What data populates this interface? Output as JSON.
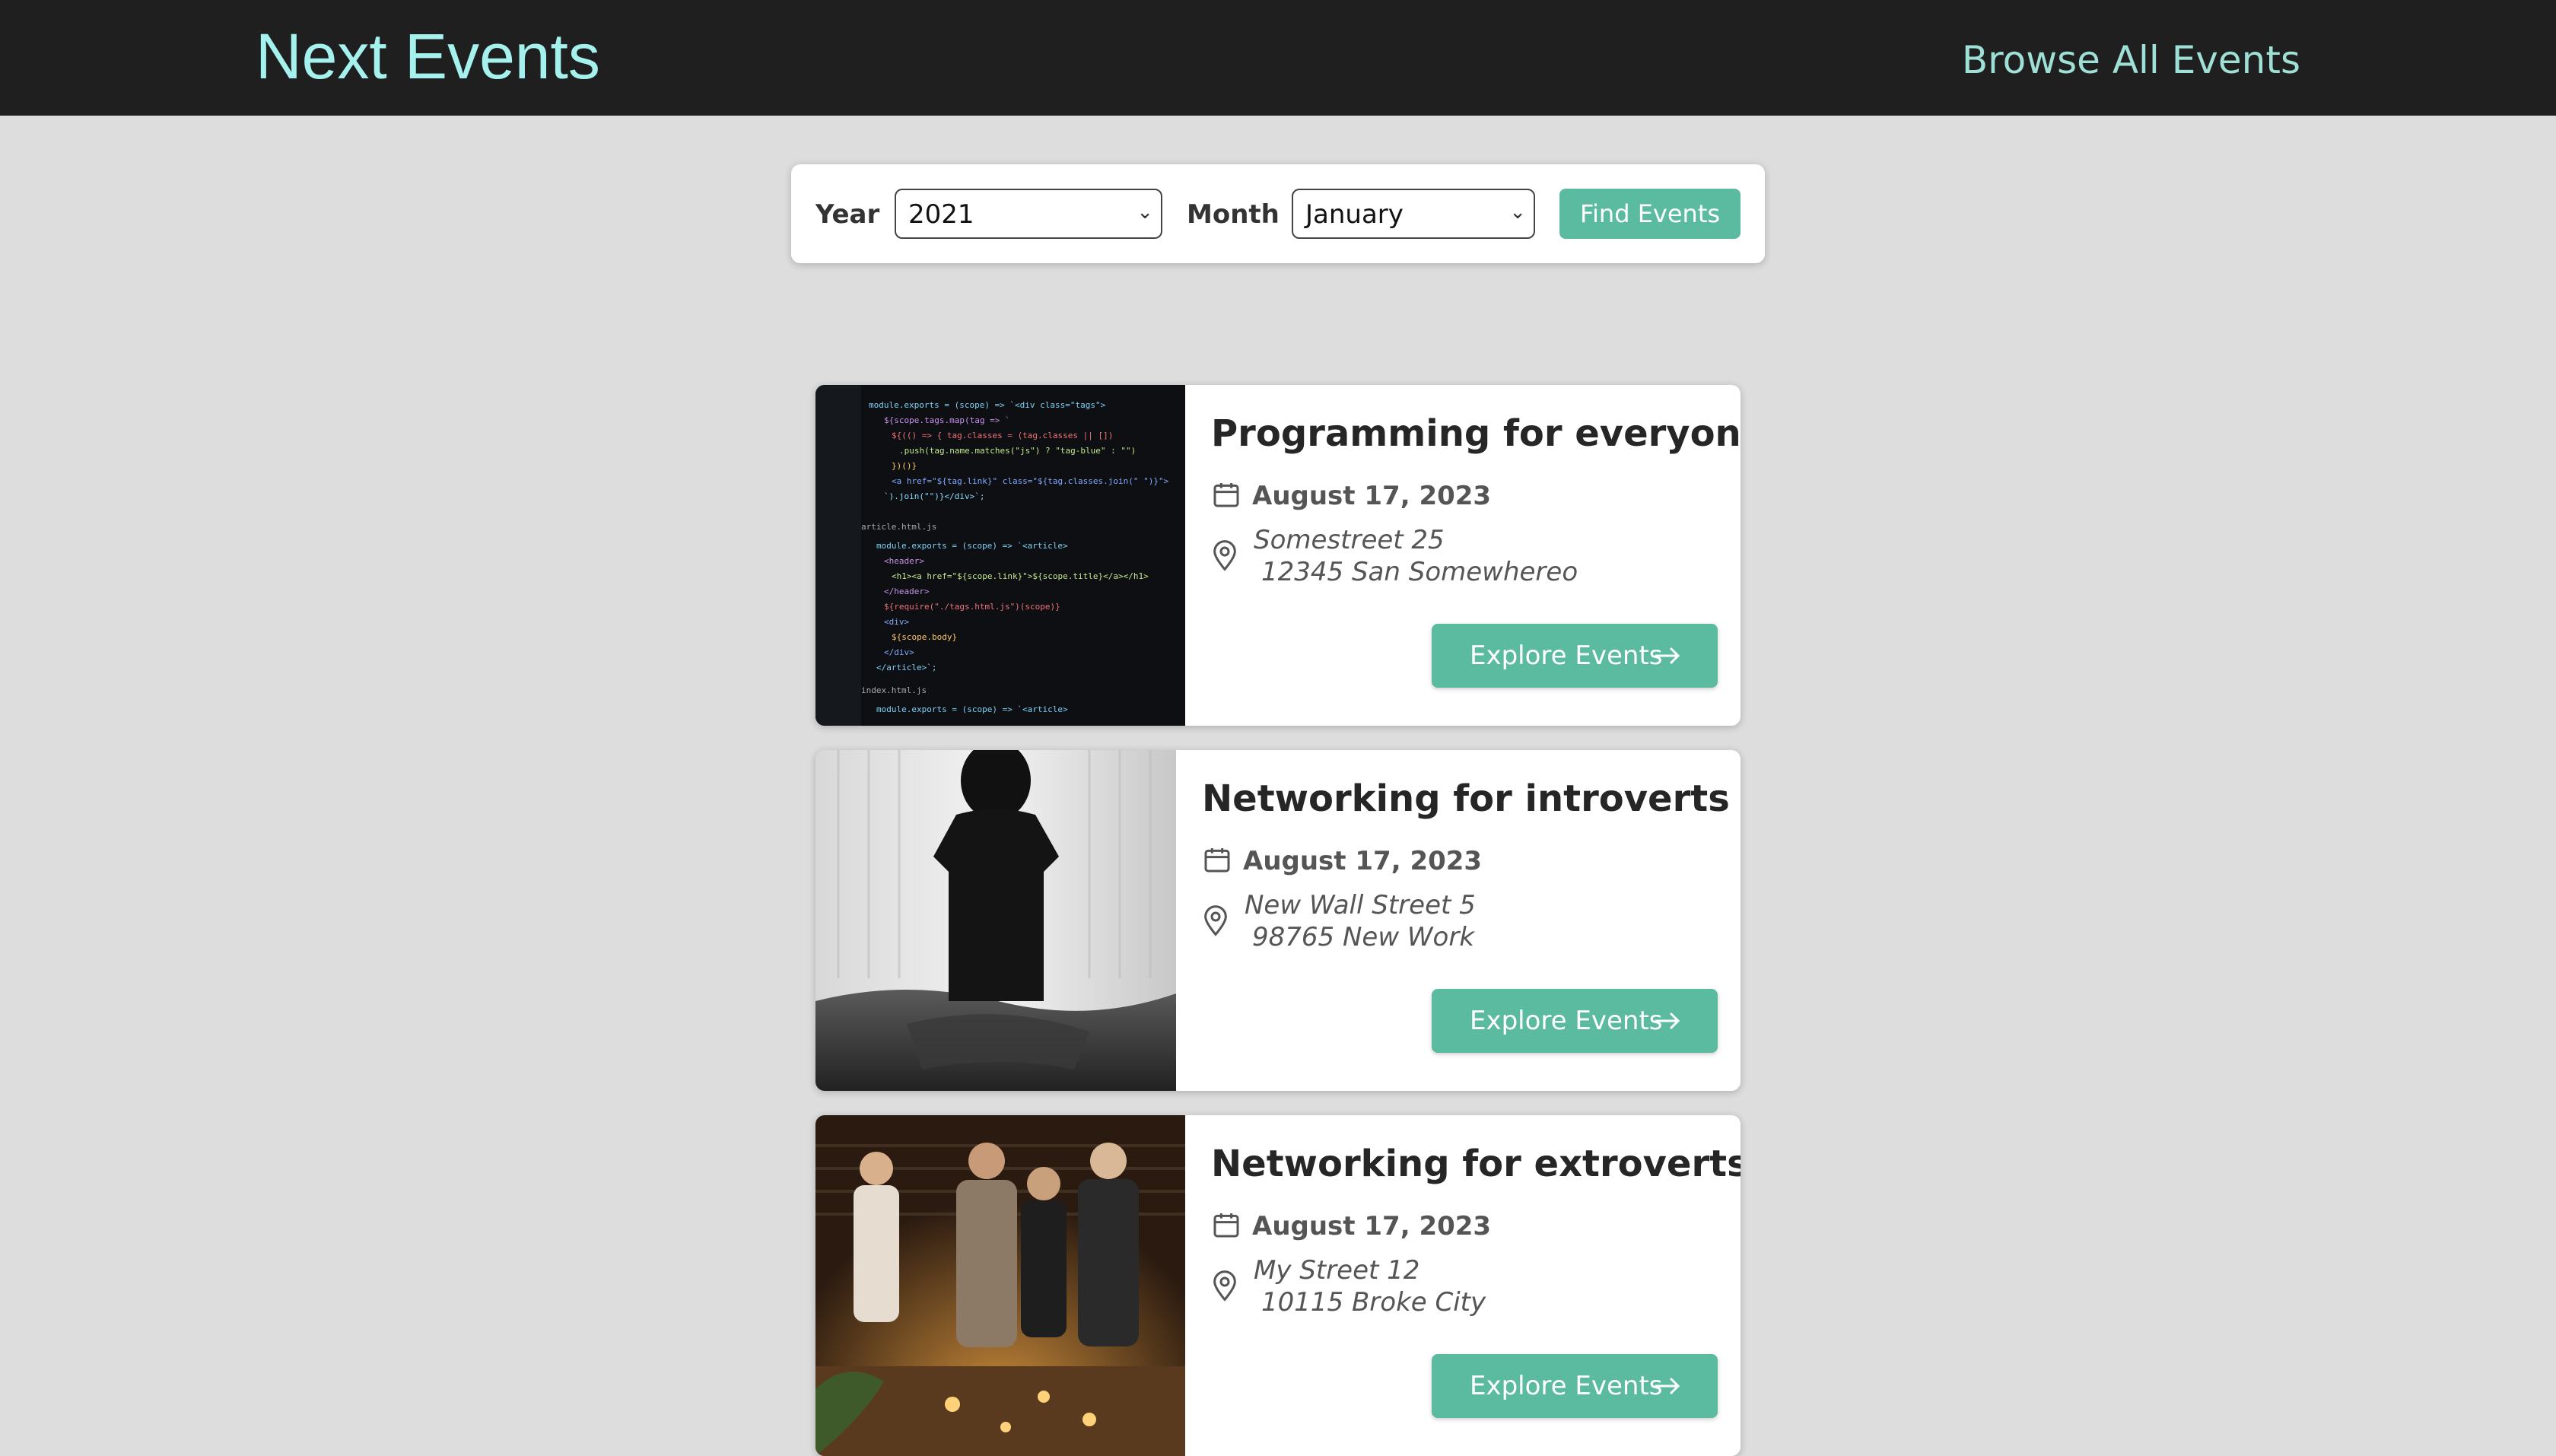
{
  "header": {
    "brand": "Next Events",
    "browse_link": "Browse All Events"
  },
  "search": {
    "year_label": "Year",
    "year_value": "2021",
    "month_label": "Month",
    "month_value": "January",
    "submit_label": "Find Events"
  },
  "events": [
    {
      "title": "Programming for everyone",
      "date": "August 17, 2023",
      "address_line1": "Somestreet 25",
      "address_line2": "12345 San Somewhereo",
      "button_label": "Explore Events",
      "image": "code-editor-photo"
    },
    {
      "title": "Networking for introverts",
      "date": "August 17, 2023",
      "address_line1": "New Wall Street 5",
      "address_line2": "98765 New Work",
      "button_label": "Explore Events",
      "image": "person-silhouette-photo"
    },
    {
      "title": "Networking for extroverts",
      "date": "August 17, 2023",
      "address_line1": "My Street 12",
      "address_line2": "10115 Broke City",
      "button_label": "Explore Events",
      "image": "party-people-photo"
    }
  ],
  "colors": {
    "header_bg": "#1f1f1f",
    "brand": "#a5f1ee",
    "link": "#9fe0d6",
    "accent": "#5bbba0",
    "page_bg": "#dddddd"
  }
}
